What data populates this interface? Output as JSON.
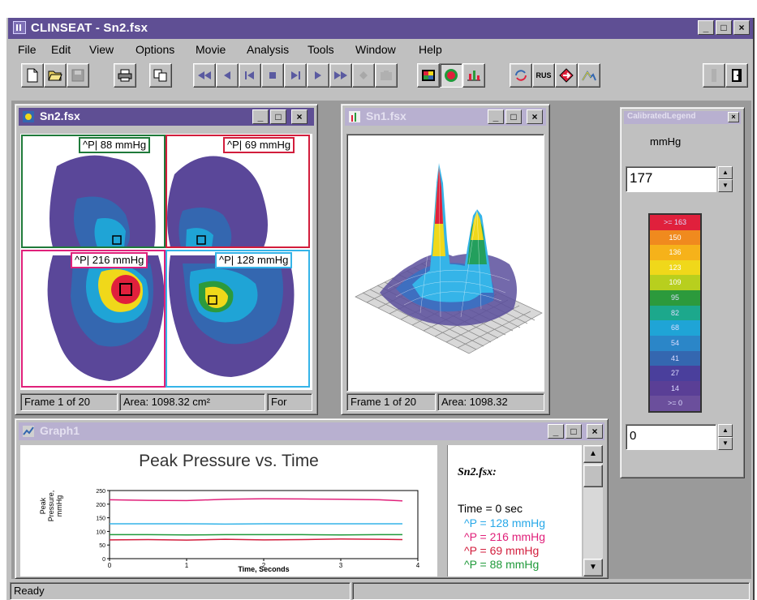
{
  "app": {
    "title": "CLINSEAT - Sn2.fsx",
    "caption_buttons": [
      "_",
      "□",
      "×"
    ]
  },
  "menu": [
    "File",
    "Edit",
    "View",
    "Options",
    "Movie",
    "Analysis",
    "Tools",
    "Window",
    "Help"
  ],
  "toolbar": {
    "rus_label": "RUS"
  },
  "sn2_window": {
    "title": "Sn2.fsx",
    "quadrants": [
      {
        "label": "^P| 88 mmHg",
        "color": "#1f7a3a"
      },
      {
        "label": "^P| 69 mmHg",
        "color": "#d21d3c"
      },
      {
        "label": "^P| 216 mmHg",
        "color": "#e0207a"
      },
      {
        "label": "^P| 128 mmHg",
        "color": "#35b4e8"
      }
    ],
    "status": {
      "frame": "Frame 1 of 20",
      "area": "Area: 1098.32 cm²",
      "extra": "For"
    }
  },
  "sn1_window": {
    "title": "Sn1.fsx",
    "status": {
      "frame": "Frame 1 of 20",
      "area": "Area: 1098.32"
    }
  },
  "legend_window": {
    "title": "CalibratedLegend",
    "unit": "mmHg",
    "max_value": "177",
    "min_value": "0",
    "levels": [
      {
        "label": ">= 163",
        "color": "#e0203c"
      },
      {
        "label": "150",
        "color": "#f08a1e"
      },
      {
        "label": "136",
        "color": "#f6b21a"
      },
      {
        "label": "123",
        "color": "#f0d81a"
      },
      {
        "label": "109",
        "color": "#b8cf1e"
      },
      {
        "label": "95",
        "color": "#2c9a3c"
      },
      {
        "label": "82",
        "color": "#1ca88c"
      },
      {
        "label": "68",
        "color": "#1fa4d6"
      },
      {
        "label": "54",
        "color": "#2b86c8"
      },
      {
        "label": "41",
        "color": "#3467b0"
      },
      {
        "label": "27",
        "color": "#4a3f9c"
      },
      {
        "label": "14",
        "color": "#5a3f96"
      },
      {
        "label": ">= 0",
        "color": "#6b4f9c"
      }
    ]
  },
  "graph_window": {
    "title": "Graph1",
    "info": {
      "file": "Sn2.fsx:",
      "time": "Time = 0 sec",
      "lines": [
        {
          "text": "^P = 128 mmHg",
          "color": "#27a8e8"
        },
        {
          "text": "^P = 216 mmHg",
          "color": "#e0207a"
        },
        {
          "text": "^P = 69 mmHg",
          "color": "#d21d3c"
        },
        {
          "text": "^P = 88 mmHg",
          "color": "#1f9a3a"
        }
      ]
    },
    "chart_data": {
      "type": "line",
      "title": "Peak Pressure vs. Time",
      "xlabel": "Time, Seconds",
      "ylabel": "Peak Pressure, mmHg",
      "xlim": [
        0,
        4
      ],
      "ylim": [
        0,
        250
      ],
      "x_ticks": [
        0,
        1,
        2,
        3,
        4
      ],
      "y_ticks": [
        0,
        50,
        100,
        150,
        200,
        250
      ],
      "x": [
        0,
        0.5,
        1,
        1.5,
        2,
        2.5,
        3,
        3.5,
        3.8
      ],
      "series": [
        {
          "color": "#e0207a",
          "values": [
            216,
            214,
            213,
            218,
            220,
            219,
            218,
            216,
            212
          ]
        },
        {
          "color": "#35b4e8",
          "values": [
            128,
            128,
            128,
            127,
            128,
            128,
            128,
            128,
            128
          ]
        },
        {
          "color": "#1f9a3a",
          "values": [
            88,
            88,
            87,
            88,
            88,
            88,
            87,
            88,
            88
          ]
        },
        {
          "color": "#d21d3c",
          "values": [
            69,
            70,
            68,
            71,
            69,
            70,
            72,
            71,
            70
          ]
        }
      ]
    }
  },
  "statusbar": {
    "text": "Ready"
  }
}
